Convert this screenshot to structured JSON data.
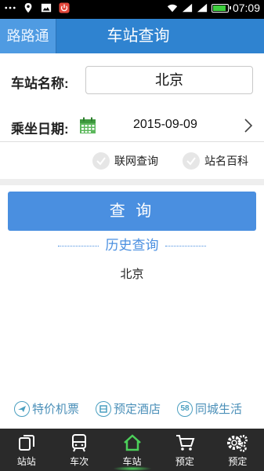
{
  "status_bar": {
    "time": "07:09",
    "battery_level": 0.9,
    "icons": [
      "more-icon",
      "location-icon",
      "image-icon",
      "power-icon",
      "wifi-icon",
      "signal-icon",
      "signal-icon",
      "battery-icon"
    ]
  },
  "header": {
    "brand": "路路通",
    "title": "车站查询"
  },
  "form": {
    "station_label": "车站名称:",
    "station_value": "北京",
    "date_label": "乘坐日期:",
    "date_value": "2015-09-09",
    "options": [
      {
        "label": "联网查询",
        "checked": false
      },
      {
        "label": "站名百科",
        "checked": false
      }
    ]
  },
  "query_button": "查 询",
  "history": {
    "title": "历史查询",
    "items": [
      "北京"
    ]
  },
  "promos": [
    {
      "label": "特价机票",
      "icon": "plane-icon"
    },
    {
      "label": "预定酒店",
      "icon": "hotel-icon"
    },
    {
      "label": "同城生活",
      "icon": "58-icon",
      "badge": "58"
    }
  ],
  "bottom_nav": [
    {
      "label": "站站",
      "icon": "copy-icon",
      "active": false
    },
    {
      "label": "车次",
      "icon": "bus-icon",
      "active": false
    },
    {
      "label": "车站",
      "icon": "home-icon",
      "active": true
    },
    {
      "label": "预定",
      "icon": "cart-icon",
      "active": false
    },
    {
      "label": "预定",
      "icon": "gear-icon",
      "active": false
    }
  ],
  "colors": {
    "title_bar": "#2f83d0",
    "accent": "#4a8fe0",
    "nav_bg": "#2a2a2a",
    "active_glow": "#4cd05a"
  }
}
